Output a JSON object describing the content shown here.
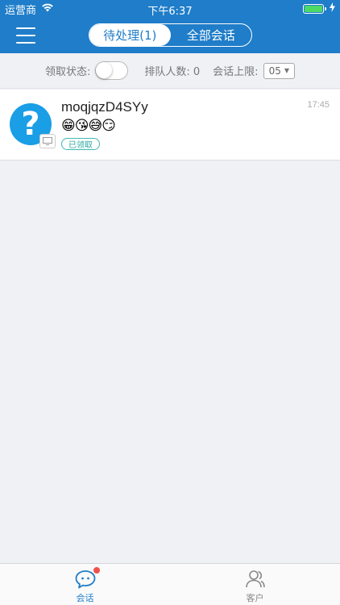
{
  "status_bar": {
    "carrier": "运营商",
    "time": "下午6:37",
    "battery_level": 1.0,
    "battery_color": "#4cd964"
  },
  "header": {
    "background": "#1f7dc9",
    "tabs": [
      {
        "label": "待处理(1)",
        "active": true
      },
      {
        "label": "全部会话",
        "active": false
      }
    ]
  },
  "filters": {
    "claim_status_label": "领取状态:",
    "claim_toggle_on": false,
    "queue_label": "排队人数: 0",
    "limit_label": "会话上限:",
    "limit_value": "05"
  },
  "sessions": [
    {
      "name": "moqjqzD4SYy",
      "message": "😁😘😅😏",
      "status_tag": "已领取",
      "time": "17:45",
      "avatar_glyph": "?",
      "device_icon": "monitor-icon"
    }
  ],
  "tabbar": {
    "items": [
      {
        "label": "会话",
        "icon": "chat-bubble-icon",
        "active": true,
        "has_badge": true
      },
      {
        "label": "客户",
        "icon": "customers-icon",
        "active": false,
        "has_badge": false
      }
    ]
  }
}
